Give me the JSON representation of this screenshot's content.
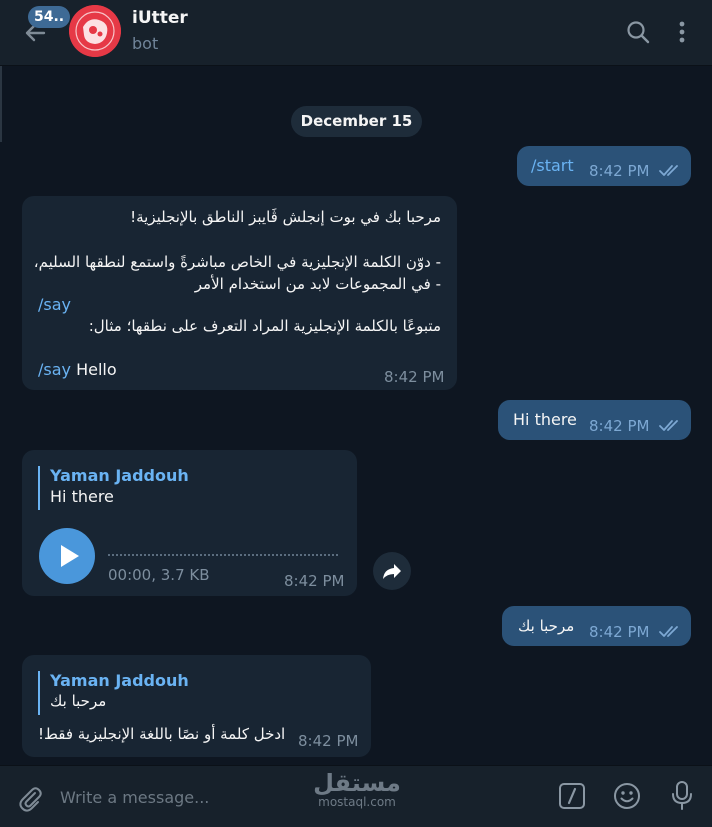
{
  "header": {
    "unread_count": "54..",
    "chat_title": "iUtter",
    "chat_subtitle": "bot"
  },
  "date_separator": "December 15",
  "messages": [
    {
      "text": "/start",
      "time": "8:42 PM"
    },
    {
      "lines": [
        "مرحبا بك في بوت إنجلش ڤَايبز الناطق بالإنجليزية!",
        "- دوّن الكلمة الإنجليزية في الخاص مباشرةً واستمع لنطقها السليم،",
        "- في المجموعات لابد من استخدام الأمر",
        "/say",
        "متبوعًا بالكلمة الإنجليزية المراد التعرف على نطقها؛ مثال:",
        "/say",
        "Hello"
      ],
      "time": "8:42 PM"
    },
    {
      "text": "Hi there",
      "time": "8:42 PM"
    },
    {
      "reply_name": "Yaman Jaddouh",
      "reply_text": "Hi there",
      "audio_info": "00:00, 3.7 KB",
      "time": "8:42 PM"
    },
    {
      "text": "مرحبا بك",
      "time": "8:42 PM"
    },
    {
      "reply_name": "Yaman Jaddouh",
      "reply_text": "مرحبا بك",
      "text": "ادخل كلمة أو نصًا باللغة الإنجليزية فقط!",
      "time": "8:42 PM"
    }
  ],
  "composer": {
    "placeholder": "Write a message..."
  },
  "watermark": {
    "logo": "مستقل",
    "site": "mostaql.com"
  },
  "colors": {
    "background": "#0e1621",
    "header": "#17212b",
    "outgoing_bubble": "#2b5278",
    "incoming_bubble": "#182533",
    "accent": "#6ab3f3",
    "avatar": "#e8333f"
  },
  "icons": [
    "back-arrow-icon",
    "search-icon",
    "more-vert-icon",
    "double-check-icon",
    "play-icon",
    "share-icon",
    "paperclip-icon",
    "bot-command-icon",
    "emoji-icon",
    "microphone-icon"
  ]
}
